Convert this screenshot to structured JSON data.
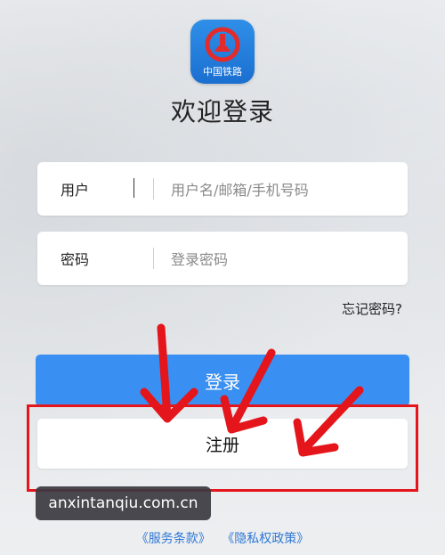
{
  "app": {
    "logo_text": "中国铁路",
    "title": "欢迎登录"
  },
  "form": {
    "user_label": "用户",
    "user_placeholder": "用户名/邮箱/手机号码",
    "password_label": "密码",
    "password_placeholder": "登录密码",
    "forgot_label": "忘记密码?"
  },
  "buttons": {
    "login_label": "登录",
    "register_label": "注册"
  },
  "watermark": {
    "text": "anxintanqiu.com.cn"
  },
  "footer": {
    "terms_label": "《服务条款》",
    "privacy_label": "《隐私权政策》"
  },
  "colors": {
    "accent": "#3a8ff2",
    "annotation": "#e4151b",
    "link": "#2f78d6"
  },
  "icons": [
    "railway-logo-icon"
  ]
}
